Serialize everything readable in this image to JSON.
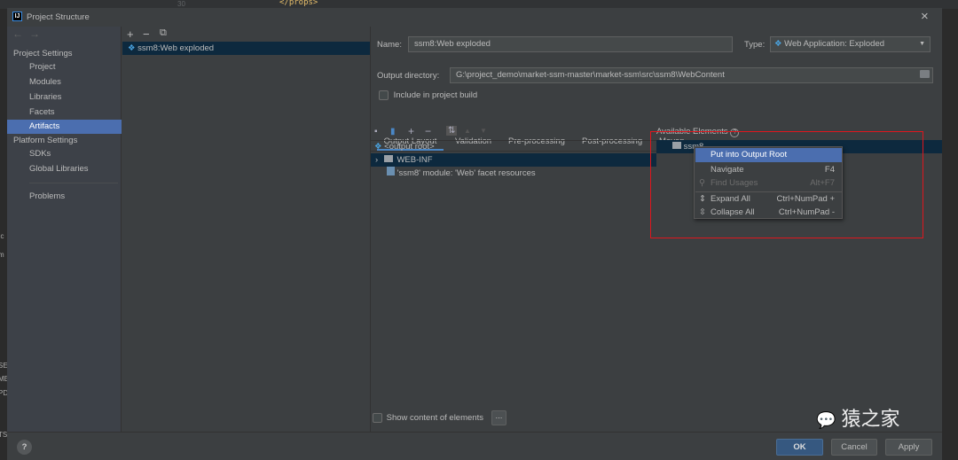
{
  "ide_background": {
    "line_number": "30",
    "code": "</props>",
    "left_fragments": [
      "nc",
      "m",
      "SE",
      "ME",
      "PD",
      "TS"
    ]
  },
  "dialog": {
    "title": "Project Structure",
    "close": "×"
  },
  "nav": {
    "back": "←",
    "forward": "→"
  },
  "sidebar": {
    "project_settings": "Project Settings",
    "items": [
      "Project",
      "Modules",
      "Libraries",
      "Facets",
      "Artifacts"
    ],
    "platform_settings": "Platform Settings",
    "platform_items": [
      "SDKs",
      "Global Libraries"
    ],
    "problems": "Problems",
    "selected": "Artifacts"
  },
  "artifacts": {
    "toolbar": [
      "+",
      "−",
      "⧉"
    ],
    "items": [
      "ssm8:Web exploded"
    ]
  },
  "form": {
    "name_label": "Name:",
    "name_value": "ssm8:Web exploded",
    "type_label": "Type:",
    "type_value": "Web Application: Exploded",
    "output_label": "Output directory:",
    "output_value": "G:\\project_demo\\market-ssm-master\\market-ssm\\src\\ssm8\\WebContent",
    "include_label": "Include in project build",
    "include_checked": false
  },
  "tabs": [
    "Output Layout",
    "Validation",
    "Pre-processing",
    "Post-processing",
    "Maven"
  ],
  "active_tab": "Output Layout",
  "layout_tree": [
    "<output root>",
    "WEB-INF",
    "'ssm8' module: 'Web' facet resources"
  ],
  "available": {
    "label": "Available Elements",
    "items": [
      "ssm8"
    ]
  },
  "context_menu": [
    {
      "label": "Put into Output Root",
      "shortcut": ""
    },
    {
      "label": "Navigate",
      "shortcut": "F4"
    },
    {
      "label": "Find Usages",
      "shortcut": "Alt+F7",
      "disabled": true
    },
    {
      "label": "Expand All",
      "shortcut": "Ctrl+NumPad +"
    },
    {
      "label": "Collapse All",
      "shortcut": "Ctrl+NumPad -"
    }
  ],
  "show_content_label": "Show content of elements",
  "show_content_btn": "...",
  "watermark": "猿之家",
  "buttons": {
    "ok": "OK",
    "cancel": "Cancel",
    "apply": "Apply",
    "help": "?"
  },
  "colors": {
    "selection": "#4b6eaf",
    "tree_selection": "#0d293e",
    "highlight_box": "#e0161d",
    "ok": "#365880"
  }
}
